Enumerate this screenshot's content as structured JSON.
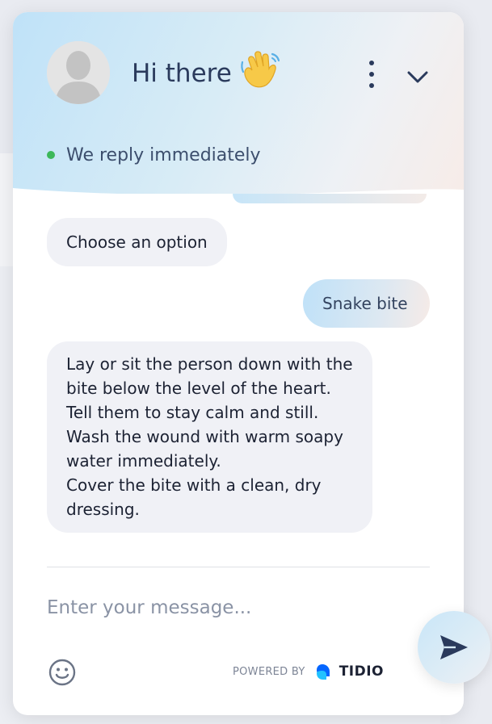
{
  "header": {
    "title": "Hi there",
    "wave_emoji": "👋",
    "status_text": "We reply immediately",
    "status_color": "#3db85a"
  },
  "messages": {
    "bot_option_prompt": "Choose an option",
    "user_choice": "Snake bite",
    "bot_instructions": "Lay or sit the person down with the\nbite below the level of the heart.\nTell them to stay calm and still.\nWash the wound with warm soapy\nwater immediately.\nCover the bite with a clean, dry\ndressing."
  },
  "composer": {
    "placeholder": "Enter your message...",
    "powered_by": "POWERED BY",
    "brand": "TIDIO"
  },
  "icons": {
    "avatar": "avatar-placeholder-icon",
    "menu": "more-vertical-icon",
    "collapse": "chevron-down-icon",
    "emoji": "smiley-icon",
    "send": "send-icon",
    "brand_logo": "tidio-logo-icon"
  },
  "colors": {
    "title_text": "#2a3a5c",
    "bubble_bg": "#f0f1f6",
    "header_gradient_start": "#bfe2f8",
    "header_gradient_end": "#f7ece8"
  }
}
